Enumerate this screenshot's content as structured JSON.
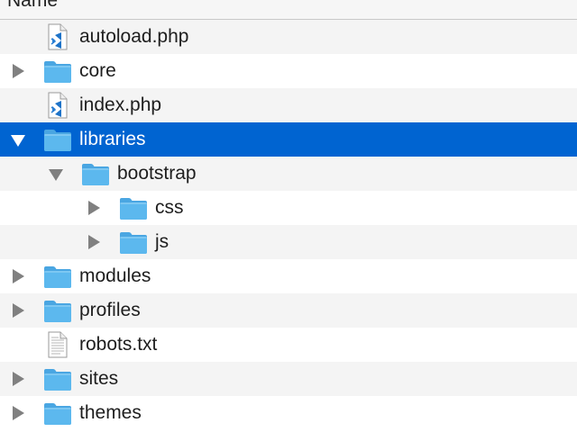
{
  "header": {
    "name_column_label": "Name"
  },
  "colors": {
    "selection": "#0064d1",
    "folder": "#5cb8ee",
    "row_stripe": "#f4f4f4"
  },
  "rows": [
    {
      "label": "autoload.php",
      "icon": "vscode-php-file-icon",
      "expandable": false,
      "expanded": false,
      "depth": 0,
      "selected": false
    },
    {
      "label": "core",
      "icon": "folder-icon",
      "expandable": true,
      "expanded": false,
      "depth": 0,
      "selected": false
    },
    {
      "label": "index.php",
      "icon": "vscode-php-file-icon",
      "expandable": false,
      "expanded": false,
      "depth": 0,
      "selected": false
    },
    {
      "label": "libraries",
      "icon": "folder-icon",
      "expandable": true,
      "expanded": true,
      "depth": 0,
      "selected": true
    },
    {
      "label": "bootstrap",
      "icon": "folder-icon",
      "expandable": true,
      "expanded": true,
      "depth": 1,
      "selected": false
    },
    {
      "label": "css",
      "icon": "folder-icon",
      "expandable": true,
      "expanded": false,
      "depth": 2,
      "selected": false
    },
    {
      "label": "js",
      "icon": "folder-icon",
      "expandable": true,
      "expanded": false,
      "depth": 2,
      "selected": false
    },
    {
      "label": "modules",
      "icon": "folder-icon",
      "expandable": true,
      "expanded": false,
      "depth": 0,
      "selected": false
    },
    {
      "label": "profiles",
      "icon": "folder-icon",
      "expandable": true,
      "expanded": false,
      "depth": 0,
      "selected": false
    },
    {
      "label": "robots.txt",
      "icon": "text-file-icon",
      "expandable": false,
      "expanded": false,
      "depth": 0,
      "selected": false
    },
    {
      "label": "sites",
      "icon": "folder-icon",
      "expandable": true,
      "expanded": false,
      "depth": 0,
      "selected": false
    },
    {
      "label": "themes",
      "icon": "folder-icon",
      "expandable": true,
      "expanded": false,
      "depth": 0,
      "selected": false
    }
  ]
}
